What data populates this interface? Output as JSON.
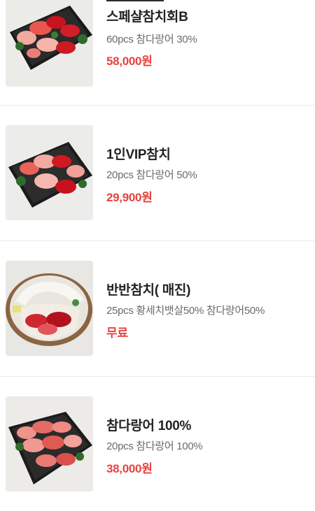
{
  "products": [
    {
      "title": "스페샬참치회B",
      "desc": "60pcs 참다랑어 30%",
      "price": "58,000원"
    },
    {
      "title": "1인VIP참치",
      "desc": "20pcs 참다랑어 50%",
      "price": "29,900원"
    },
    {
      "title": "반반참치( 매진)",
      "desc": "25pcs 황세치뱃살50% 참다랑어50%",
      "price": "무료"
    },
    {
      "title": "참다랑어 100%",
      "desc": "20pcs 참다랑어 100%",
      "price": "38,000원"
    }
  ]
}
